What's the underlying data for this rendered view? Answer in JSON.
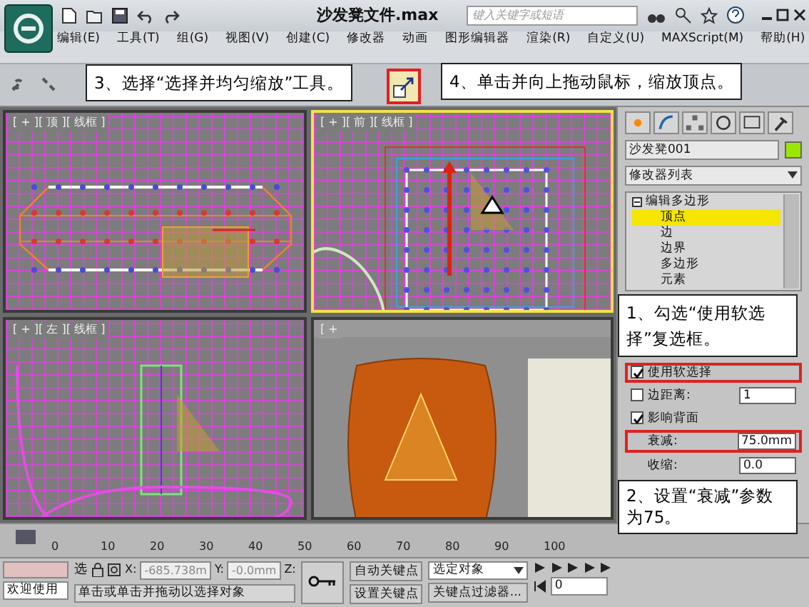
{
  "window": {
    "title": "沙发凳文件.max",
    "search_placeholder": "键入关键字或短语"
  },
  "menu": [
    {
      "label": "编辑(E)"
    },
    {
      "label": "工具(T)"
    },
    {
      "label": "组(G)"
    },
    {
      "label": "视图(V)"
    },
    {
      "label": "创建(C)"
    },
    {
      "label": "修改器"
    },
    {
      "label": "动画"
    },
    {
      "label": "图形编辑器"
    },
    {
      "label": "渲染(R)"
    },
    {
      "label": "自定义(U)"
    },
    {
      "label": "MAXScript(M)"
    },
    {
      "label": "帮助(H)"
    }
  ],
  "toolbar": {
    "scale_tool_highlighted": true
  },
  "viewports": [
    {
      "label": "[ + ][ 顶 ][ 线框 ]",
      "kind": "top",
      "selected": false
    },
    {
      "label": "[ + ][ 前 ][ 线框 ]",
      "kind": "front",
      "selected": true
    },
    {
      "label": "[ + ][ 左 ][ 线框 ]",
      "kind": "left",
      "selected": false
    },
    {
      "label": "[ +",
      "kind": "perspective",
      "selected": false
    }
  ],
  "command_panel": {
    "object_name": "沙发凳001",
    "modifier_list": "修改器列表",
    "modifier_stack": [
      {
        "label": "编辑多边形",
        "expanded": true,
        "children": [
          {
            "label": "顶点",
            "selected": true
          },
          {
            "label": "边",
            "selected": false
          },
          {
            "label": "边界",
            "selected": false
          },
          {
            "label": "多边形",
            "selected": false
          },
          {
            "label": "元素",
            "selected": false
          }
        ]
      }
    ],
    "soft_selection": [
      {
        "kind": "checkbox",
        "label": "使用软选择",
        "checked": true,
        "highlighted": true
      },
      {
        "kind": "checkbox-spinner",
        "label": "边距离:",
        "checked": false,
        "value": "1",
        "highlighted": false
      },
      {
        "kind": "checkbox",
        "label": "影响背面",
        "checked": true,
        "highlighted": false
      },
      {
        "kind": "spinner",
        "label": "衰减:",
        "value": "75.0mm",
        "highlighted": true
      },
      {
        "kind": "spinner",
        "label": "收缩:",
        "value": "0.0",
        "highlighted": false
      }
    ]
  },
  "callouts": [
    {
      "text": "3、选择“选择并均匀缩放”工具。"
    },
    {
      "text": "4、单击并向上拖动鼠标，缩放顶点。"
    },
    {
      "text": "1、勾选“使用软选择”复选框。"
    },
    {
      "text": "2、设置“衰减”参数为75。"
    }
  ],
  "timeline": {
    "ticks": [
      "0",
      "10",
      "20",
      "30",
      "40",
      "50",
      "60",
      "70",
      "80",
      "90",
      "100"
    ]
  },
  "status_bar": {
    "welcome": "欢迎使用",
    "selection_label": "选",
    "x_label": "X:",
    "x": "-685.738m",
    "y_label": "Y:",
    "y": "-0.0mm",
    "z_label": "Z:",
    "auto_key": "自动关键点",
    "set_key": "设置关键点",
    "key_mode": "选定对象",
    "key_filters": "关键点过滤器...",
    "frame": "0",
    "prompt": "单击或单击并拖动以选择对象"
  }
}
